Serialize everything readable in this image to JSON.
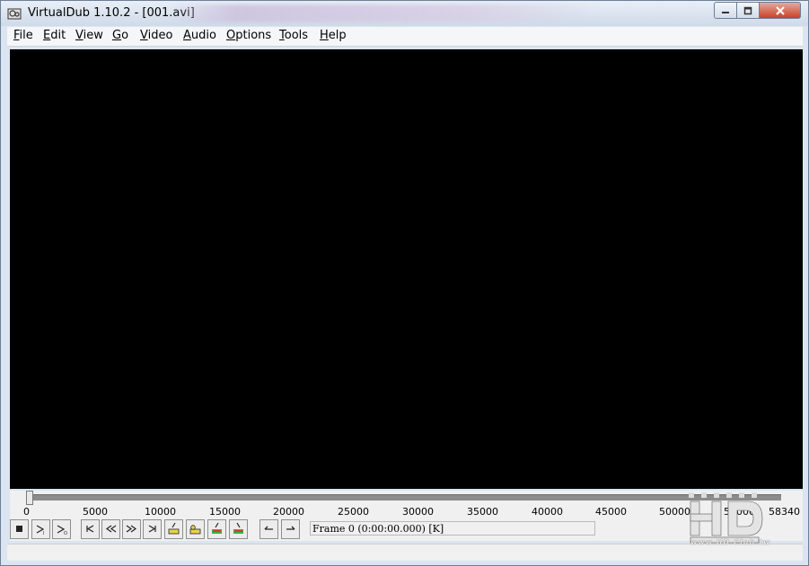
{
  "window": {
    "title": "VirtualDub 1.10.2 - [001.avi]"
  },
  "menu": [
    {
      "label": "File",
      "key": "F",
      "rest": "ile"
    },
    {
      "label": "Edit",
      "key": "E",
      "rest": "dit"
    },
    {
      "label": "View",
      "key": "V",
      "rest": "iew"
    },
    {
      "label": "Go",
      "key": "G",
      "rest": "o"
    },
    {
      "label": "Video",
      "key": "V",
      "rest": "ideo"
    },
    {
      "label": "Audio",
      "key": "A",
      "rest": "udio"
    },
    {
      "label": "Options",
      "key": "O",
      "rest": "ptions"
    },
    {
      "label": "Tools",
      "key": "T",
      "rest": "ools"
    },
    {
      "label": "Help",
      "key": "H",
      "rest": "elp"
    }
  ],
  "timeline": {
    "ticks": [
      "0",
      "5000",
      "10000",
      "15000",
      "20000",
      "25000",
      "30000",
      "35000",
      "40000",
      "45000",
      "50000",
      "55000",
      "58340"
    ],
    "position": 0,
    "total": 58340
  },
  "status": {
    "frame_text": "Frame 0 (0:00:00.000) [K]"
  },
  "watermark": {
    "site": "www.HD.Club.tw"
  },
  "colors": {
    "video_bg": "#000000",
    "window_bg": "#dbe5f1"
  },
  "icons": [
    "app-icon",
    "minimize-icon",
    "maximize-icon",
    "close-icon",
    "stop-icon",
    "play-input-icon",
    "play-output-icon",
    "start-icon",
    "prev-frame-icon",
    "next-frame-icon",
    "end-icon",
    "prev-key-icon",
    "next-key-icon",
    "prev-scene-icon",
    "next-scene-icon",
    "mark-in-icon",
    "mark-out-icon"
  ]
}
